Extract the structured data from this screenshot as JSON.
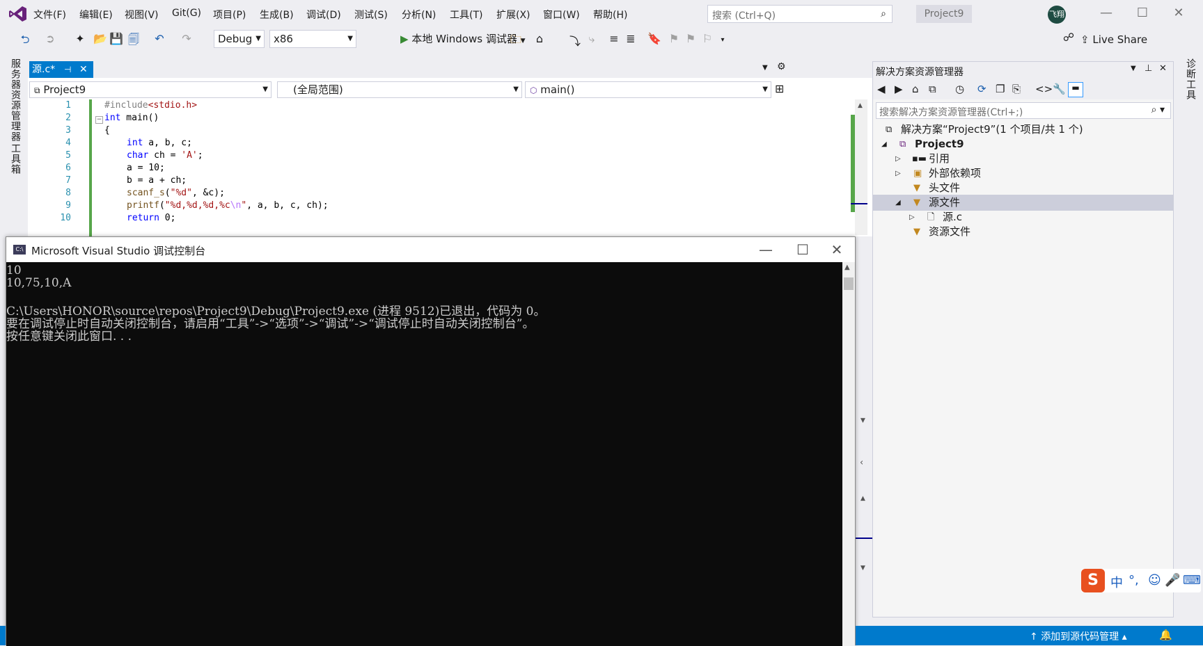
{
  "menubar": {
    "items": [
      "文件(F)",
      "编辑(E)",
      "视图(V)",
      "Git(G)",
      "项目(P)",
      "生成(B)",
      "调试(D)",
      "测试(S)",
      "分析(N)",
      "工具(T)",
      "扩展(X)",
      "窗口(W)",
      "帮助(H)"
    ],
    "search_placeholder": "搜索 (Ctrl+Q)",
    "project_name": "Project9",
    "avatar_text": "飞翔",
    "minimize": "—",
    "maximize": "☐",
    "close": "✕"
  },
  "toolbar": {
    "config": "Debug",
    "platform": "x86",
    "run_label": "本地 Windows 调试器",
    "live_share": "Live Share"
  },
  "left_rail": {
    "tab1": "服务器资源管理器",
    "tab2": "工具箱"
  },
  "right_rail": {
    "tab1": "诊断工具"
  },
  "editor": {
    "tab_title": "源.c*",
    "tab_pin": "⊣",
    "tab_close": "✕",
    "nav_project": "Project9",
    "nav_scope": "(全局范围)",
    "nav_member": "main()",
    "line_numbers": [
      "1",
      "2",
      "3",
      "4",
      "5",
      "6",
      "7",
      "8",
      "9",
      "10"
    ],
    "code": {
      "l1_pp": "#include",
      "l1_hdr": "<stdio.h>",
      "l2_kw": "int",
      "l2_rest": " main()",
      "l3": "{",
      "l4_kw": "int",
      "l4_rest": " a, b, c;",
      "l5_kw": "char",
      "l5_rest": " ch = ",
      "l5_str": "'A'",
      "l5_end": ";",
      "l6": "a = 10;",
      "l7": "b = a + ch;",
      "l8_fn": "scanf_s",
      "l8_open": "(",
      "l8_str": "\"%d\"",
      "l8_rest": ", &c);",
      "l9_fn": "printf",
      "l9_open": "(",
      "l9_str": "\"%d,%d,%d,%c",
      "l9_esc": "\\n",
      "l9_str2": "\"",
      "l9_rest": ", a, b, c, ch);",
      "l10_kw": "return",
      "l10_rest": " 0;"
    }
  },
  "console": {
    "icon_text": "C:\\",
    "title": "Microsoft Visual Studio 调试控制台",
    "lines": [
      "10",
      "10,75,10,A",
      "",
      "C:\\Users\\HONOR\\source\\repos\\Project9\\Debug\\Project9.exe (进程 9512)已退出，代码为 0。",
      "要在调试停止时自动关闭控制台，请启用“工具”->“选项”->“调试”->“调试停止时自动关闭控制台”。",
      "按任意键关闭此窗口. . ."
    ],
    "minimize": "—",
    "maximize": "☐",
    "close": "✕"
  },
  "solution_explorer": {
    "title": "解决方案资源管理器",
    "search_placeholder": "搜索解决方案资源管理器(Ctrl+;)",
    "tree": [
      {
        "label": "解决方案“Project9”(1 个项目/共 1 个)",
        "icon": "solution-icon",
        "expander": ""
      },
      {
        "label": "Project9",
        "icon": "project-icon",
        "expander": "◢"
      },
      {
        "label": "引用",
        "icon": "references-icon",
        "expander": "▷"
      },
      {
        "label": "外部依赖项",
        "icon": "external-deps-icon",
        "expander": "▷"
      },
      {
        "label": "头文件",
        "icon": "folder-icon",
        "expander": ""
      },
      {
        "label": "源文件",
        "icon": "folder-icon",
        "expander": "◢"
      },
      {
        "label": "源.c",
        "icon": "c-file-icon",
        "expander": "▷"
      },
      {
        "label": "资源文件",
        "icon": "folder-icon",
        "expander": ""
      }
    ]
  },
  "statusbar": {
    "source_control": "添加到源代码管理",
    "source_control_up": "↑",
    "source_control_caret": "▴"
  },
  "ime": {
    "logo": "S",
    "lang": "中",
    "punct": "°,"
  },
  "colors": {
    "accent": "#007acc",
    "console_bg": "#0c0c0c",
    "console_text": "#cccccc",
    "keyword": "#0000ff",
    "string": "#a31515",
    "line_number": "#2b91af",
    "run_green": "#388a34"
  }
}
